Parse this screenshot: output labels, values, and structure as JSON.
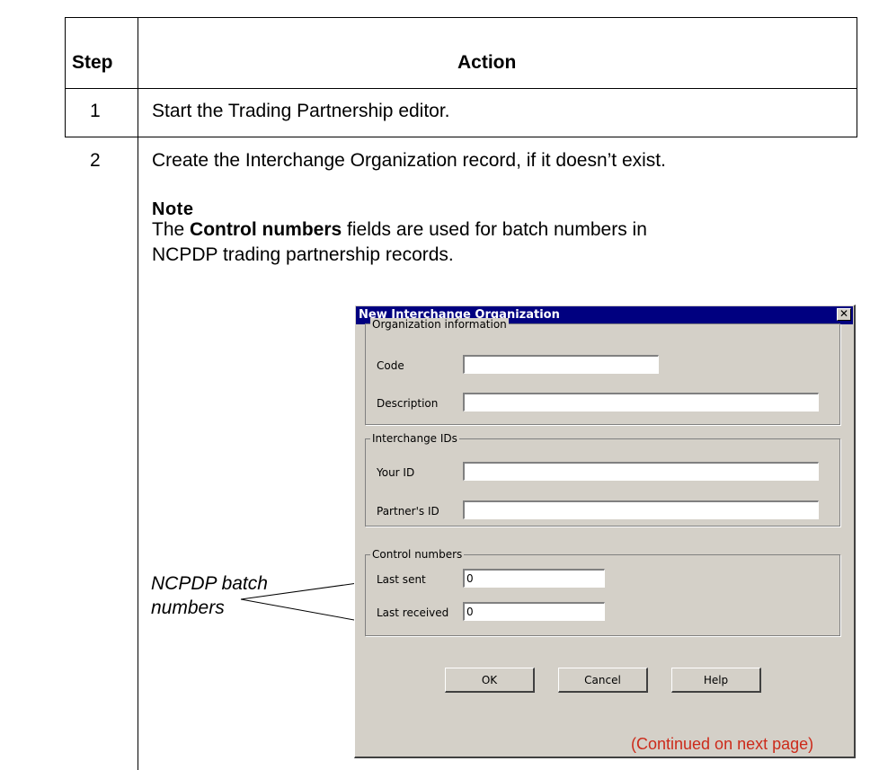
{
  "table": {
    "headers": {
      "step": "Step",
      "action": "Action"
    },
    "rows": [
      {
        "step": "1",
        "action": "Start the Trading Partnership editor."
      },
      {
        "step": "2",
        "action": "Create the Interchange Organization record, if it doesn’t exist."
      }
    ]
  },
  "note": {
    "title": "Note",
    "text_before": "The ",
    "bold": "Control numbers",
    "text_after": " fields are used for batch numbers in NCPDP trading partnership records."
  },
  "callout": {
    "line1": "NCPDP batch",
    "line2": "numbers"
  },
  "continued": "(Continued on next page)",
  "dialog": {
    "title": "New Interchange Organization",
    "close_glyph": "✕",
    "groups": {
      "org_info": {
        "legend": "Organization information",
        "code_label": "Code",
        "code_value": "",
        "description_label": "Description",
        "description_value": ""
      },
      "interchange_ids": {
        "legend": "Interchange IDs",
        "your_id_label": "Your ID",
        "your_id_value": "",
        "partner_id_label": "Partner's ID",
        "partner_id_value": ""
      },
      "control_numbers": {
        "legend": "Control numbers",
        "last_sent_label": "Last sent",
        "last_sent_value": "0",
        "last_received_label": "Last received",
        "last_received_value": "0"
      }
    },
    "buttons": {
      "ok": "OK",
      "cancel": "Cancel",
      "help": "Help"
    }
  }
}
